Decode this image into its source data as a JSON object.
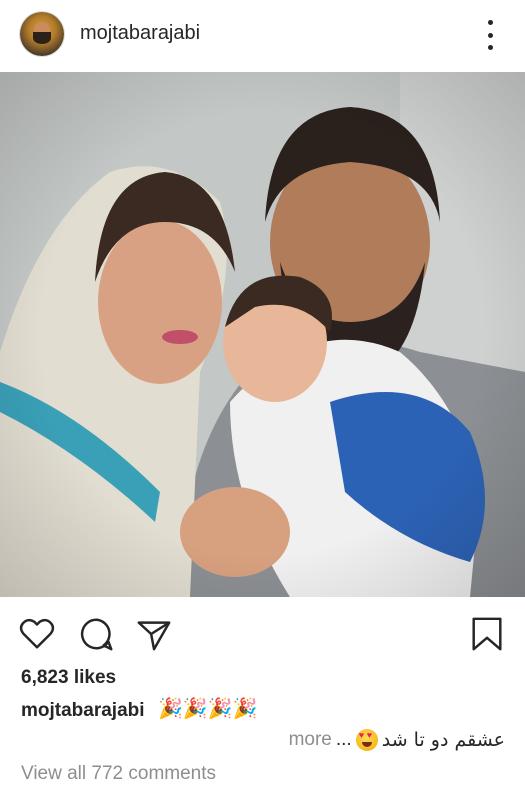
{
  "post": {
    "username": "mojtabarajabi",
    "likes": "6,823 likes",
    "caption": {
      "username": "mojtabarajabi",
      "emojis": "🎉🎉🎉🎉",
      "text": "عشقم دو تا شد",
      "more_label": "more",
      "ellipsis": "..."
    },
    "view_all_comments": "View all 772 comments"
  },
  "icons": {
    "more": "vertical-ellipsis-icon",
    "like": "heart-outline-icon",
    "comment": "speech-bubble-icon",
    "share": "paper-plane-icon",
    "save": "bookmark-icon",
    "emoji": "heart-eyes-emoji"
  },
  "colors": {
    "text": "#262626",
    "muted": "#8e8e8e"
  }
}
